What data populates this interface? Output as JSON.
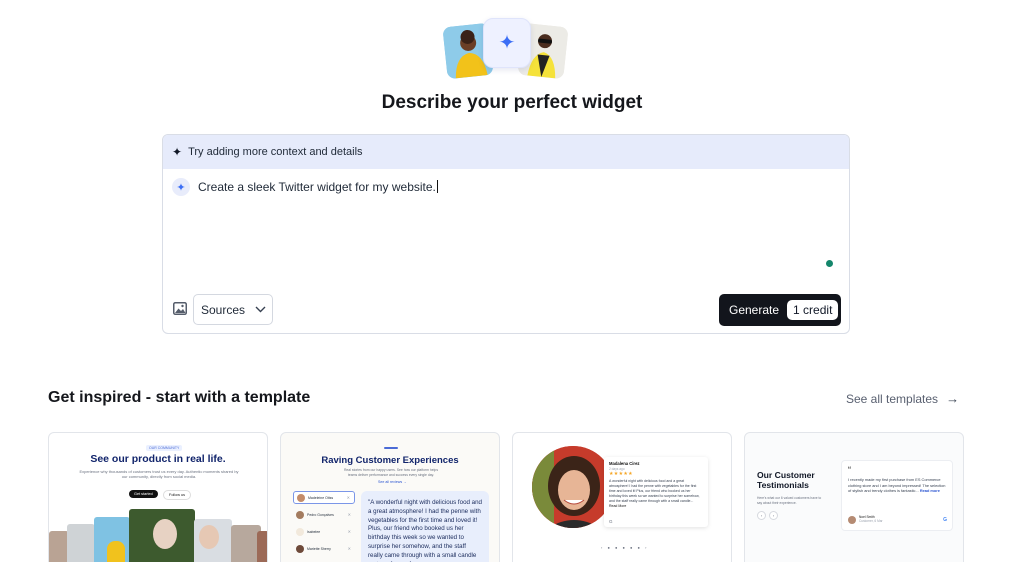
{
  "header": {
    "title": "Describe your perfect widget"
  },
  "prompt": {
    "hint": "Try adding more context and details",
    "text": "Create a sleek Twitter widget for my website.",
    "sources_label": "Sources",
    "generate_label": "Generate",
    "credit_label": "1 credit",
    "status_color": "#14866b"
  },
  "templates": {
    "section_title": "Get inspired - start with a template",
    "see_all_label": "See all templates",
    "cards": [
      {
        "tag": "OUR COMMUNITY",
        "heading": "See our product in real life.",
        "subtext": "Experience why thousands of customers trust us every day. Authentic moments shared by our community, directly from social media.",
        "primary_button": "Get started",
        "secondary_button": "Follow us"
      },
      {
        "heading": "Raving Customer Experiences",
        "subtext": "Real stories from our happy users. See how our platform helps teams deliver performance and success every single day.",
        "link": "See all reviews →",
        "list": [
          "Madeleine Otiss",
          "Pedro Gonçalves",
          "Isabelee",
          "Mariette Sherry"
        ],
        "quote": "\"A wonderful night with delicious food and a great atmosphere! I had the penne with vegetables for the first time and loved it! Plus, our friend who booked us her birthday this week so we wanted to surprise her somehow, and the staff really came through with a small candle on top of one of"
      },
      {
        "name": "Madalena Cirez",
        "date": "2 days ago",
        "stars": "★★★★★",
        "body": "A wonderful night with delicious food and a great atmosphere! I had the penne with vegetables for the first time and loved it! Plus, our friend who booked us her birthday this week so we wanted to surprise her somehow, and the staff really came through with a small candle...",
        "more": "Read More"
      },
      {
        "heading": "Our Customer Testimonials",
        "subtext": "Here's what our 6 valued customers have to say about their experience.",
        "quote_mark": "“",
        "body": "I recently made my first purchase from ES Commerce clothing store and I am beyond impressed! The selection of stylish and trendy clothes is fantastic...",
        "read_more": "Read more",
        "author": "Noel Smith",
        "author_meta": "Customer, 6 Mar"
      }
    ]
  }
}
